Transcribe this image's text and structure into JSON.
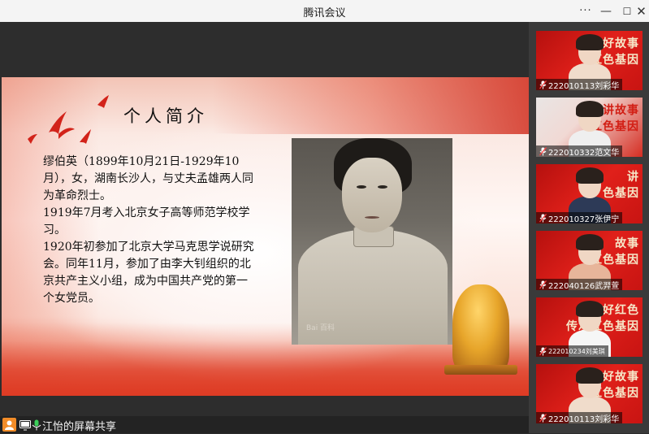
{
  "window": {
    "title": "腾讯会议",
    "more_icon": "more-horizontal-icon",
    "controls": {
      "minimize": "—",
      "maximize": "☐",
      "close": "✕"
    }
  },
  "shared_screen": {
    "heading": "个人简介",
    "paragraphs": [
      "缪伯英（1899年10月21日-1929年10月），女，湖南长沙人，与丈夫孟雄两人同为革命烈士。",
      "1919年7月考入北京女子高等师范学校学习。",
      "1920年初参加了北京大学马克思学说研究会。同年11月，参加了由李大钊组织的北京共产主义小组，成为中国共产党的第一个女党员。"
    ],
    "portrait_watermark": "Bai 百科",
    "accent_color": "#d9301f"
  },
  "participants": [
    {
      "name": "222010113刘彩华",
      "banner": [
        "讲好故事",
        "红色基因"
      ],
      "mic_icon": "mic-muted-icon"
    },
    {
      "name": "222010332范文华",
      "banner": [
        "讲故事",
        "红色基因"
      ],
      "mic_icon": "mic-muted-icon"
    },
    {
      "name": "222010327张伊宁",
      "banner": [
        "讲",
        "色基因"
      ],
      "mic_icon": "mic-muted-icon"
    },
    {
      "name": "222040126武羿萱",
      "banner": [
        "故事",
        "红色基因"
      ],
      "mic_icon": "mic-muted-icon"
    },
    {
      "name": "222010234刘美琪",
      "banner": [
        "讲好红色",
        "传承红色基因"
      ],
      "mic_icon": "mic-muted-icon"
    },
    {
      "name": "222010113刘彩华",
      "banner": [
        "讲好故事",
        "红色基因"
      ],
      "mic_icon": "mic-muted-icon"
    }
  ],
  "status_bar": {
    "label": "江怡的屏幕共享",
    "user_icon": "user-icon",
    "screen_icon": "screen-share-icon",
    "mic_icon": "microphone-icon"
  }
}
